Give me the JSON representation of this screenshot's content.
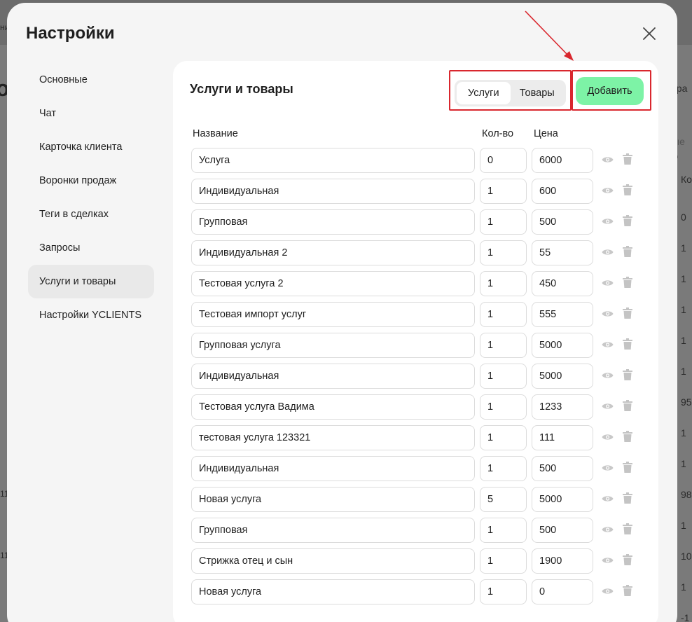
{
  "background": {
    "top_fragment": "ни",
    "right_fragment": "ора",
    "right_small": "ые д",
    "right_col_head": "Ко",
    "left_fragment_1": "11",
    "left_fragment_2": "11",
    "right_values": [
      "0",
      "1",
      "1",
      "1",
      "1",
      "1",
      "95",
      "1",
      "1",
      "98",
      "1",
      "10",
      "1",
      "-1"
    ],
    "big_letter": "о"
  },
  "modal": {
    "title": "Настройки"
  },
  "nav": {
    "items": [
      {
        "label": "Основные"
      },
      {
        "label": "Чат"
      },
      {
        "label": "Карточка клиента"
      },
      {
        "label": "Воронки продаж"
      },
      {
        "label": "Теги в сделках"
      },
      {
        "label": "Запросы"
      },
      {
        "label": "Услуги и товары",
        "active": true
      },
      {
        "label": "Настройки YCLIENTS"
      }
    ]
  },
  "panel": {
    "title": "Услуги и товары",
    "segment": {
      "services": "Услуги",
      "goods": "Товары"
    },
    "add_label": "Добавить",
    "columns": {
      "name": "Название",
      "qty": "Кол-во",
      "price": "Цена"
    }
  },
  "items": [
    {
      "name": "Услуга",
      "qty": "0",
      "price": "6000"
    },
    {
      "name": "Индивидуальная",
      "qty": "1",
      "price": "600"
    },
    {
      "name": "Групповая",
      "qty": "1",
      "price": "500"
    },
    {
      "name": "Индивидуальная 2",
      "qty": "1",
      "price": "55"
    },
    {
      "name": "Тестовая услуга 2",
      "qty": "1",
      "price": "450"
    },
    {
      "name": "Тестовая импорт услуг",
      "qty": "1",
      "price": "555"
    },
    {
      "name": "Групповая услуга",
      "qty": "1",
      "price": "5000"
    },
    {
      "name": "Индивидуальная",
      "qty": "1",
      "price": "5000"
    },
    {
      "name": "Тестовая услуга Вадима",
      "qty": "1",
      "price": "1233"
    },
    {
      "name": "тестовая услуга 123321",
      "qty": "1",
      "price": "111"
    },
    {
      "name": "Индивидуальная",
      "qty": "1",
      "price": "500"
    },
    {
      "name": "Новая услуга",
      "qty": "5",
      "price": "5000"
    },
    {
      "name": "Групповая",
      "qty": "1",
      "price": "500"
    },
    {
      "name": "Стрижка отец и сын",
      "qty": "1",
      "price": "1900"
    },
    {
      "name": "Новая услуга",
      "qty": "1",
      "price": "0"
    }
  ],
  "colors": {
    "accent_green": "#7df3a6",
    "annotation_red": "#d9272e",
    "icon_grey": "#c4c4c4"
  },
  "icons": {
    "close": "close-icon",
    "visibility": "eye-icon",
    "delete": "trash-icon"
  }
}
